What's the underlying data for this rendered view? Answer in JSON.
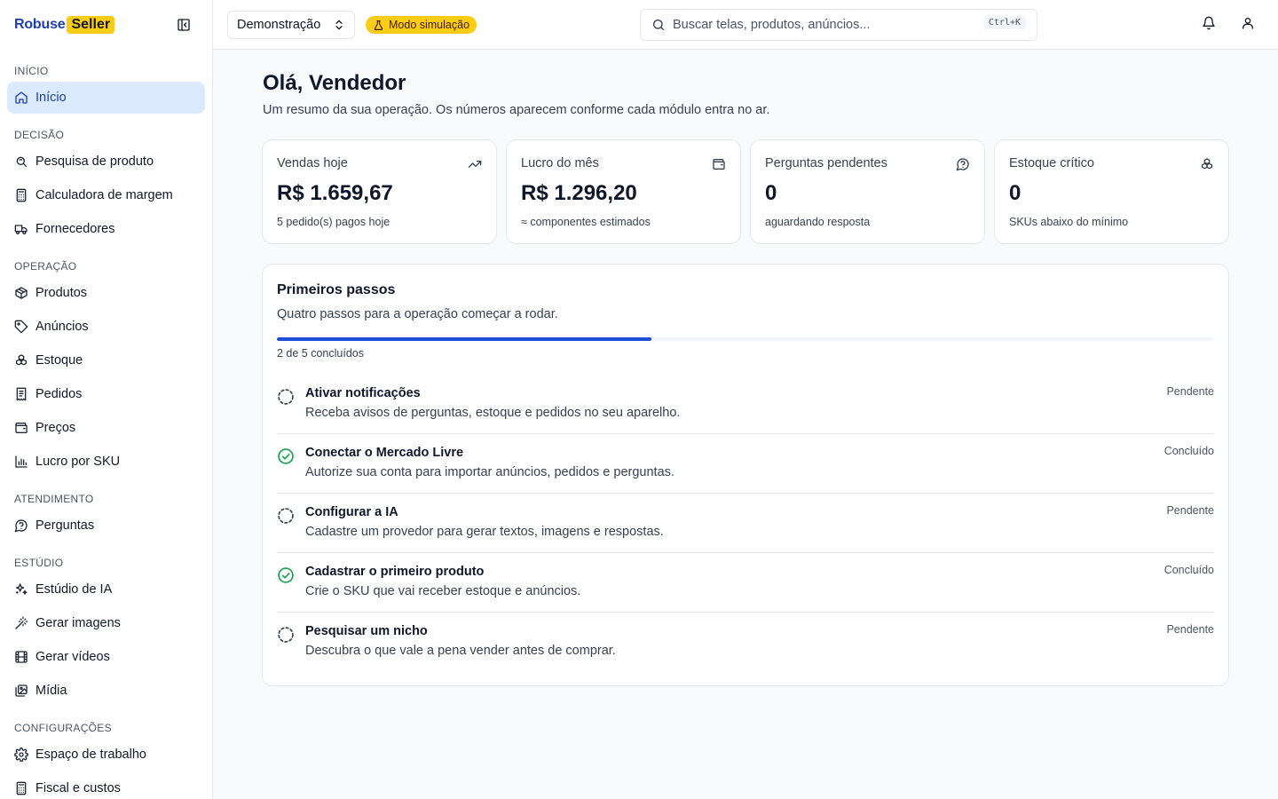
{
  "brand": {
    "name": "Robuse",
    "tag": "Seller"
  },
  "sidebar": {
    "sections": [
      {
        "title": "INÍCIO",
        "items": [
          {
            "label": "Início",
            "icon": "home-icon",
            "active": true
          }
        ]
      },
      {
        "title": "DECISÃO",
        "items": [
          {
            "label": "Pesquisa de produto",
            "icon": "search-icon"
          },
          {
            "label": "Calculadora de margem",
            "icon": "calculator-icon"
          },
          {
            "label": "Fornecedores",
            "icon": "truck-icon"
          }
        ]
      },
      {
        "title": "OPERAÇÃO",
        "items": [
          {
            "label": "Produtos",
            "icon": "package-icon"
          },
          {
            "label": "Anúncios",
            "icon": "tag-icon"
          },
          {
            "label": "Estoque",
            "icon": "boxes-icon"
          },
          {
            "label": "Pedidos",
            "icon": "receipt-icon"
          },
          {
            "label": "Preços",
            "icon": "wallet-icon"
          },
          {
            "label": "Lucro por SKU",
            "icon": "bar-chart-icon"
          }
        ]
      },
      {
        "title": "ATENDIMENTO",
        "items": [
          {
            "label": "Perguntas",
            "icon": "question-bubble-icon"
          }
        ]
      },
      {
        "title": "ESTÚDIO",
        "items": [
          {
            "label": "Estúdio de IA",
            "icon": "sparkles-icon"
          },
          {
            "label": "Gerar imagens",
            "icon": "wand-icon"
          },
          {
            "label": "Gerar vídeos",
            "icon": "film-icon"
          },
          {
            "label": "Mídia",
            "icon": "images-icon"
          }
        ]
      },
      {
        "title": "CONFIGURAÇÕES",
        "items": [
          {
            "label": "Espaço de trabalho",
            "icon": "gear-icon"
          },
          {
            "label": "Fiscal e custos",
            "icon": "calculator-icon"
          }
        ]
      }
    ]
  },
  "topbar": {
    "workspace": "Demonstração",
    "sim_badge": "Modo simulação",
    "search_placeholder": "Buscar telas, produtos, anúncios...",
    "shortcut": "Ctrl+K"
  },
  "main": {
    "title": "Olá, Vendedor",
    "subtitle": "Um resumo da sua operação. Os números aparecem conforme cada módulo entra no ar.",
    "kpis": [
      {
        "label": "Vendas hoje",
        "value": "R$ 1.659,67",
        "hint": "5 pedido(s) pagos hoje",
        "icon": "trending-up-icon"
      },
      {
        "label": "Lucro do mês",
        "value": "R$ 1.296,20",
        "hint": "≈ componentes estimados",
        "icon": "wallet-icon"
      },
      {
        "label": "Perguntas pendentes",
        "value": "0",
        "hint": "aguardando resposta",
        "icon": "question-bubble-icon"
      },
      {
        "label": "Estoque crítico",
        "value": "0",
        "hint": "SKUs abaixo do mínimo",
        "icon": "boxes-icon"
      }
    ],
    "steps": {
      "title": "Primeiros passos",
      "subtitle": "Quatro passos para a operação começar a rodar.",
      "progress": 0.4,
      "progress_text": "2 de 5 concluídos",
      "items": [
        {
          "title": "Ativar notificações",
          "desc": "Receba avisos de perguntas, estoque e pedidos no seu aparelho.",
          "status": "Pendente",
          "done": false
        },
        {
          "title": "Conectar o Mercado Livre",
          "desc": "Autorize sua conta para importar anúncios, pedidos e perguntas.",
          "status": "Concluído",
          "done": true
        },
        {
          "title": "Configurar a IA",
          "desc": "Cadastre um provedor para gerar textos, imagens e respostas.",
          "status": "Pendente",
          "done": false
        },
        {
          "title": "Cadastrar o primeiro produto",
          "desc": "Crie o SKU que vai receber estoque e anúncios.",
          "status": "Concluído",
          "done": true
        },
        {
          "title": "Pesquisar um nicho",
          "desc": "Descubra o que vale a pena vender antes de comprar.",
          "status": "Pendente",
          "done": false
        }
      ]
    }
  },
  "colors": {
    "accent": "#1d4ed8",
    "brand_tag": "#facc15",
    "success": "#16a34a",
    "active_bg": "#dbeafe"
  }
}
